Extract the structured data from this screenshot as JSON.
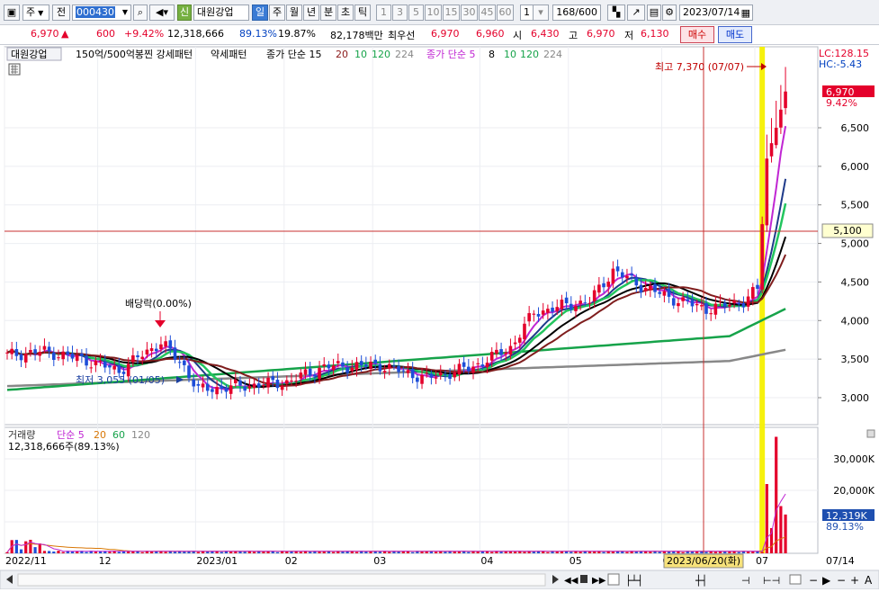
{
  "toolbar": {
    "type_select": "주",
    "jeon_label": "전",
    "stock_code": "000430",
    "shin_label": "신",
    "stock_name": "대원강업",
    "period_buttons": [
      "일",
      "주",
      "월",
      "년",
      "분",
      "초",
      "틱"
    ],
    "active_period": "일",
    "minute_buttons": [
      "1",
      "3",
      "5",
      "10",
      "15",
      "30",
      "45",
      "60"
    ],
    "interval_value": "1",
    "count_value": "168",
    "count_total": "/600",
    "date_value": "2023/07/14"
  },
  "quote": {
    "price": "6,970",
    "change_arrow": "▲",
    "change": "600",
    "change_pct": "+9.42%",
    "volume": "12,318,666",
    "volume_ratio": "89.13%",
    "turnover": "19.87%",
    "amount": "82,178백만",
    "priority_label": "최우선",
    "ask": "6,970",
    "bid": "6,960",
    "open_label": "시",
    "open": "6,430",
    "high_label": "고",
    "high": "6,970",
    "low_label": "저",
    "low": "6,130",
    "buy_label": "매수",
    "sell_label": "매도"
  },
  "legend": {
    "stock_tag": "대원강업",
    "pattern_text": "150억/500억봉찐 강세패턴",
    "weak_text": "약세패턴",
    "ma_title": "종가 단순 15",
    "ma_periods_a": [
      "20",
      "10",
      "120",
      "224"
    ],
    "ma2_title": "종가 단순 5",
    "ma_periods_b": [
      "8",
      "10",
      "120",
      "224"
    ],
    "lc_text": "LC:128.15",
    "hc_text": "HC:-5.43"
  },
  "annotations": {
    "max_label": "최고 7,370 (07/07)",
    "min_label": "최저 3,055 (01/05)",
    "dividend_label": "배당락(0.00%)",
    "current_price_tag": "6,970",
    "current_pct_tag": "9.42%",
    "crosshair_price_tag": "5,100",
    "crosshair_date_tag": "2023/06/20(화)"
  },
  "volume_legend": {
    "title": "거래량",
    "ma_title": "단순 5",
    "ma_periods": [
      "20",
      "60",
      "120"
    ],
    "current_text": "12,318,666주(89.13%)",
    "current_tag": "12,319K",
    "ratio_tag": "89.13%"
  },
  "bottom_bar": {
    "last_date": "07/14"
  },
  "chart_data": {
    "type": "candlestick",
    "title": "대원강업",
    "price_axis": {
      "ticks": [
        3000,
        3500,
        4000,
        4500,
        5000,
        5500,
        6000,
        6500
      ],
      "tick_labels": [
        "3,000",
        "3,500",
        "4,000",
        "4,500",
        "5,000",
        "5,500",
        "6,000",
        "6,500"
      ],
      "range": [
        2650,
        7550
      ]
    },
    "volume_axis": {
      "ticks": [
        10000,
        20000,
        30000
      ],
      "tick_labels": [
        "",
        "20,000K",
        "30,000K"
      ],
      "range": [
        0,
        40000
      ]
    },
    "x_labels": [
      {
        "label": "2022/11",
        "index": 0
      },
      {
        "label": "12",
        "index": 20
      },
      {
        "label": "2023/01",
        "index": 41
      },
      {
        "label": "02",
        "index": 60
      },
      {
        "label": "03",
        "index": 79
      },
      {
        "label": "04",
        "index": 102
      },
      {
        "label": "05",
        "index": 121
      },
      {
        "label": "06",
        "index": 141
      },
      {
        "label": "07",
        "index": 161
      }
    ],
    "key_points": [
      {
        "i": 0,
        "close": 3550
      },
      {
        "i": 8,
        "close": 3600
      },
      {
        "i": 16,
        "close": 3500
      },
      {
        "i": 24,
        "close": 3350
      },
      {
        "i": 33,
        "close": 3720
      },
      {
        "i": 38,
        "close": 3400
      },
      {
        "i": 41,
        "close": 3100
      },
      {
        "i": 50,
        "close": 3150
      },
      {
        "i": 60,
        "close": 3200
      },
      {
        "i": 68,
        "close": 3400
      },
      {
        "i": 80,
        "close": 3420
      },
      {
        "i": 90,
        "close": 3250
      },
      {
        "i": 100,
        "close": 3400
      },
      {
        "i": 108,
        "close": 3650
      },
      {
        "i": 113,
        "close": 4100
      },
      {
        "i": 120,
        "close": 4200
      },
      {
        "i": 125,
        "close": 4250
      },
      {
        "i": 130,
        "close": 4650
      },
      {
        "i": 136,
        "close": 4450
      },
      {
        "i": 142,
        "close": 4300
      },
      {
        "i": 150,
        "close": 4150
      },
      {
        "i": 158,
        "close": 4250
      },
      {
        "i": 161,
        "close": 4400
      },
      {
        "i": 163,
        "close": 6100
      },
      {
        "i": 165,
        "close": 6500
      },
      {
        "i": 167,
        "close": 6970
      }
    ],
    "volume_spikes": [
      {
        "i": 163,
        "volume": 22000
      },
      {
        "i": 165,
        "volume": 37000
      },
      {
        "i": 167,
        "volume": 12319
      }
    ],
    "moving_averages": [
      "5",
      "8",
      "10",
      "15",
      "20",
      "120",
      "224"
    ],
    "highlight_date": "2023/06/20(화)",
    "crosshair_price": 5100
  }
}
